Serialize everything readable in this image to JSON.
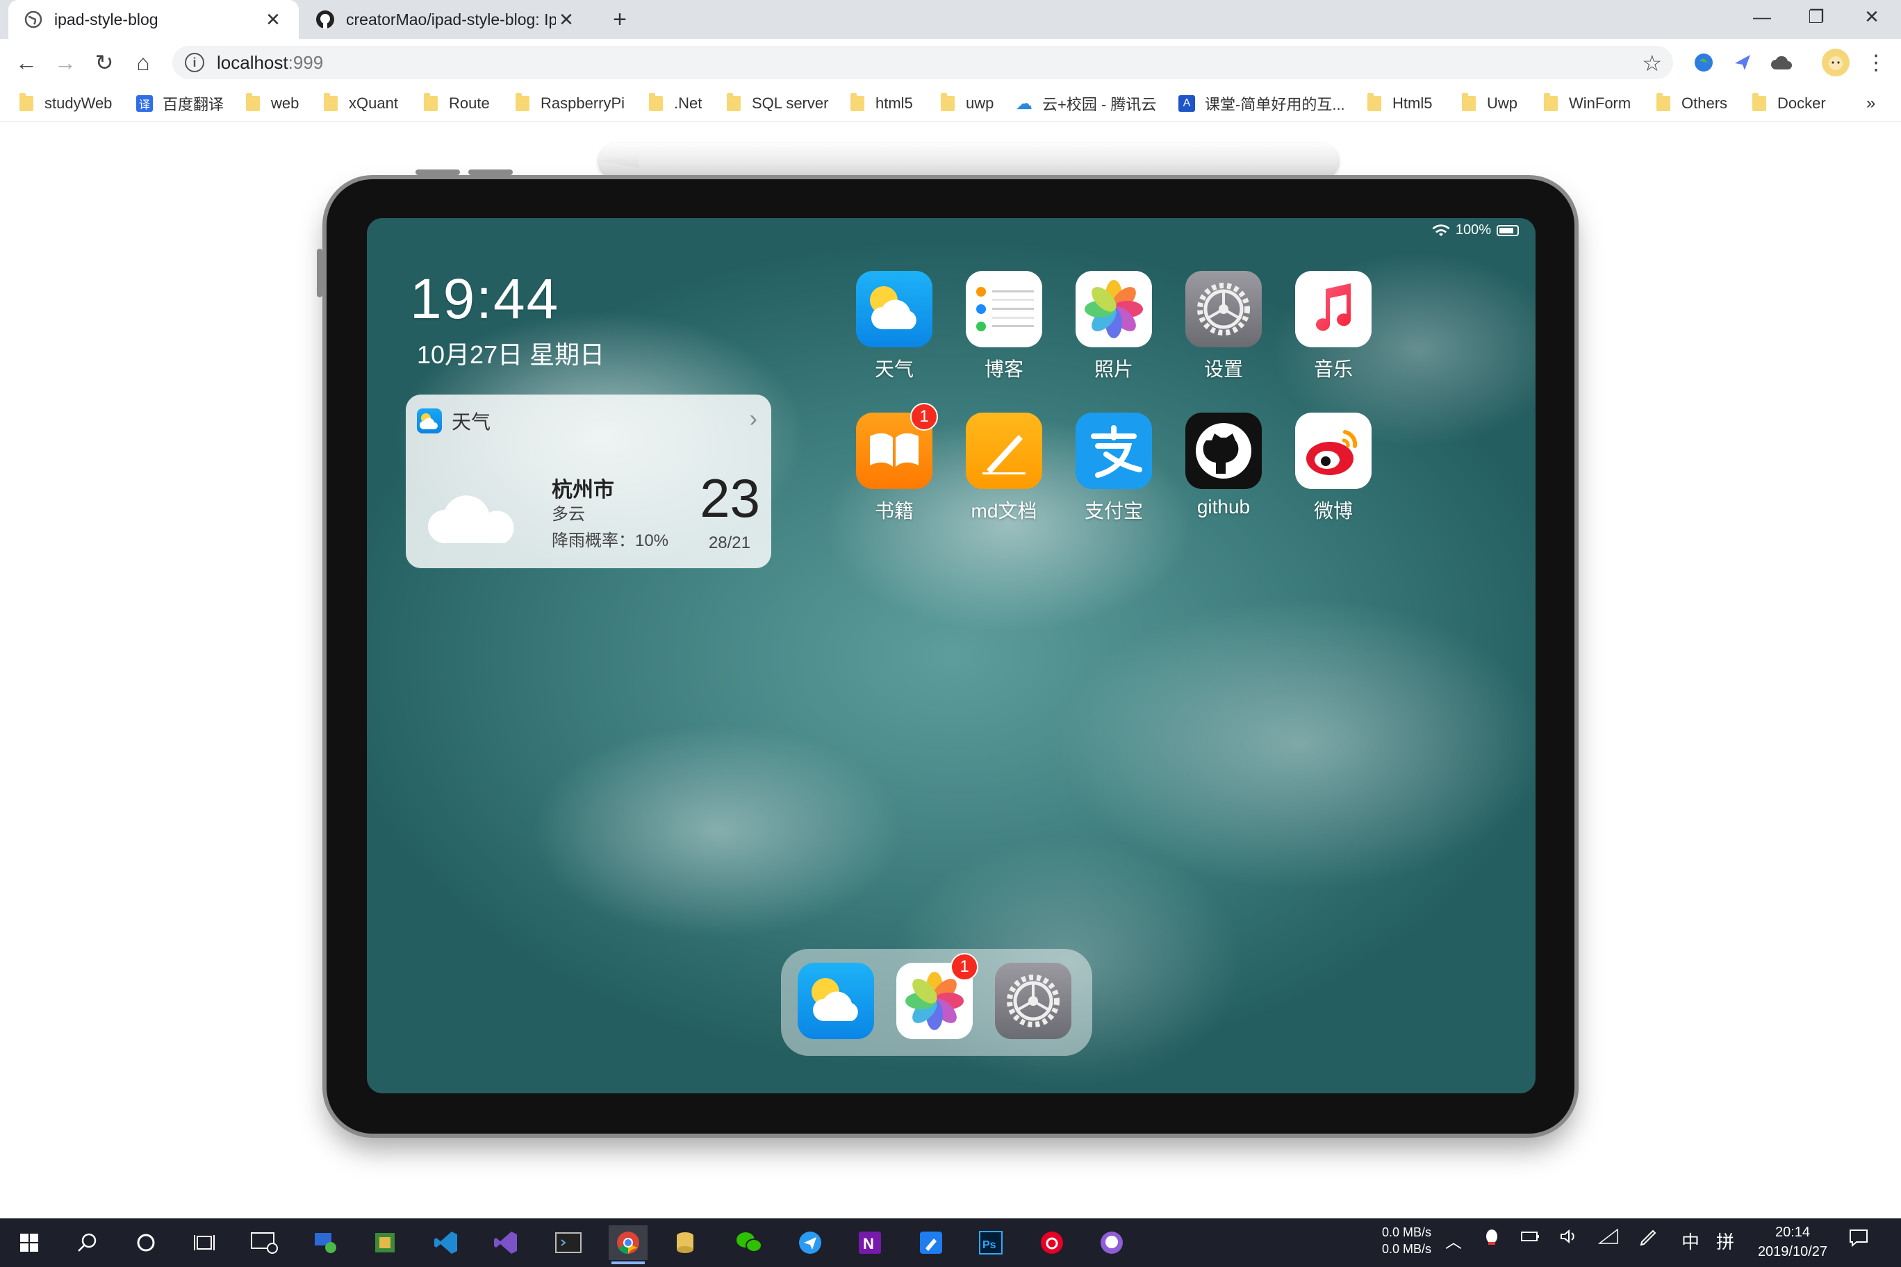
{
  "tabs": [
    {
      "title": "ipad-style-blog",
      "icon": "globe-icon"
    },
    {
      "title": "creatorMao/ipad-style-blog: Ip",
      "icon": "github-icon"
    }
  ],
  "address": {
    "host": "localhost",
    "port": ":999"
  },
  "bookmarks": [
    {
      "label": "studyWeb",
      "type": "folder"
    },
    {
      "label": "百度翻译",
      "type": "site",
      "glyph": "译",
      "color": "#2f6fe6"
    },
    {
      "label": "web",
      "type": "folder"
    },
    {
      "label": "xQuant",
      "type": "folder"
    },
    {
      "label": "Route",
      "type": "folder"
    },
    {
      "label": "RaspberryPi",
      "type": "folder"
    },
    {
      "label": ".Net",
      "type": "folder"
    },
    {
      "label": "SQL server",
      "type": "folder"
    },
    {
      "label": "html5",
      "type": "folder"
    },
    {
      "label": "uwp",
      "type": "folder"
    },
    {
      "label": "云+校园 - 腾讯云",
      "type": "site",
      "glyph": "☁",
      "color": "#2b88d8"
    },
    {
      "label": "课堂-简单好用的互...",
      "type": "site",
      "glyph": "A",
      "color": "#1e55c8"
    },
    {
      "label": "Html5",
      "type": "folder"
    },
    {
      "label": "Uwp",
      "type": "folder"
    },
    {
      "label": "WinForm",
      "type": "folder"
    },
    {
      "label": "Others",
      "type": "folder"
    },
    {
      "label": "Docker",
      "type": "folder"
    }
  ],
  "bookmarks_more": "»",
  "ipad": {
    "status": {
      "battery": "100%"
    },
    "clock": "19:44",
    "date": "10月27日 星期日",
    "widget": {
      "title": "天气",
      "city": "杭州市",
      "condition": "多云",
      "rain": "降雨概率：10%",
      "temperature": "23",
      "range": "28/21"
    },
    "apps_row1": [
      {
        "label": "天气",
        "icon": "weather-icon"
      },
      {
        "label": "博客",
        "icon": "reminders-icon"
      },
      {
        "label": "照片",
        "icon": "photos-icon"
      },
      {
        "label": "设置",
        "icon": "settings-icon"
      },
      {
        "label": "音乐",
        "icon": "music-icon"
      }
    ],
    "apps_row2": [
      {
        "label": "书籍",
        "icon": "books-icon",
        "badge": "1"
      },
      {
        "label": "md文档",
        "icon": "pages-icon"
      },
      {
        "label": "支付宝",
        "icon": "alipay-icon"
      },
      {
        "label": "github",
        "icon": "github-icon"
      },
      {
        "label": "微博",
        "icon": "weibo-icon"
      }
    ],
    "dock": [
      {
        "icon": "weather-icon"
      },
      {
        "icon": "photos-icon",
        "badge": "1"
      },
      {
        "icon": "settings-icon"
      }
    ]
  },
  "taskbar": {
    "net_up": "0.0 MB/s",
    "net_down": "0.0 MB/s",
    "ime1": "中",
    "ime2": "拼",
    "time": "20:14",
    "date": "2019/10/27"
  }
}
